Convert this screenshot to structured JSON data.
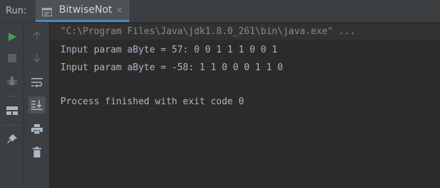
{
  "run_panel": {
    "label": "Run:",
    "tab": {
      "title": "BitwiseNot",
      "close": "×"
    }
  },
  "console": {
    "lines": [
      "\"C:\\Program Files\\Java\\jdk1.8.0_261\\bin\\java.exe\" ...",
      "Input param aByte = 57: 0 0 1 1 1 0 0 1",
      "Input param aByte = -58: 1 1 0 0 0 1 1 0",
      "",
      "Process finished with exit code 0"
    ]
  },
  "toolbar": {
    "left": [
      "run-icon",
      "stop-icon",
      "debug-icon",
      "layout-icon",
      "pin-icon"
    ],
    "right": [
      "up-arrow-icon",
      "down-arrow-icon",
      "soft-wrap-icon",
      "scroll-to-end-icon",
      "print-icon",
      "trash-icon"
    ]
  },
  "colors": {
    "background": "#2b2b2b",
    "panel": "#3c3f41",
    "text": "#a9b7c6",
    "command_text": "#8a8a8a",
    "run_green": "#499c54",
    "accent": "#4a88c7"
  }
}
